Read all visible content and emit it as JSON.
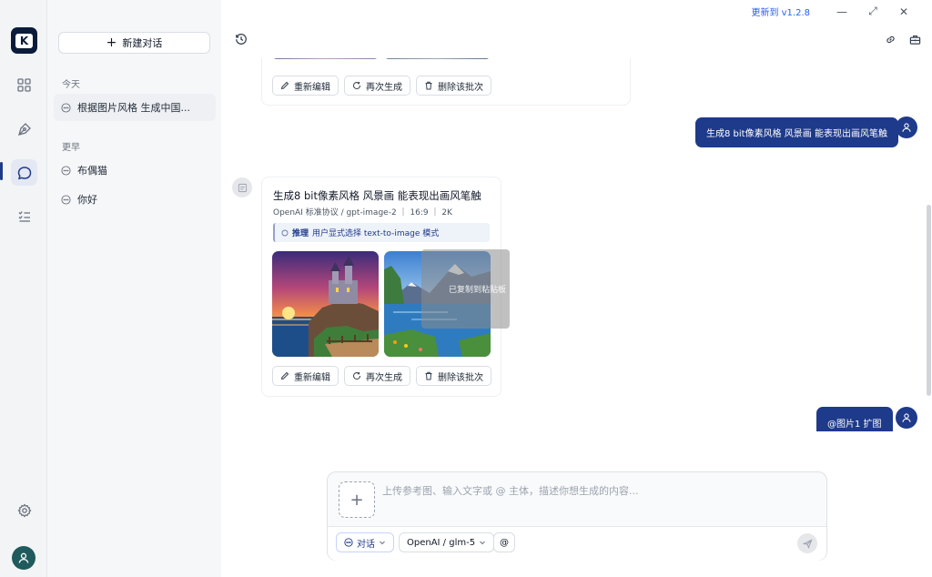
{
  "app": {
    "logo_letter": "K",
    "accent": "#1e3a8a"
  },
  "titlebar": {
    "update_label": "更新到 v1.2.8",
    "minimize": "—",
    "maximize": "⤢",
    "close": "✕"
  },
  "sidebar": {
    "new_chat_label": "新建对话",
    "groups": [
      {
        "label": "今天",
        "items": [
          {
            "title": "根据图片风格 生成中国..."
          }
        ]
      },
      {
        "label": "更早",
        "items": [
          {
            "title": "布偶猫"
          },
          {
            "title": "你好"
          }
        ]
      }
    ]
  },
  "messages": {
    "top_batch": {
      "actions": [
        "重新编辑",
        "再次生成",
        "删除该批次"
      ]
    },
    "user_1": {
      "text": "生成8 bit像素风格 风景画 能表现出画风笔触"
    },
    "assistant_1": {
      "title": "生成8 bit像素风格 风景画 能表现出画风笔触",
      "meta": "OpenAI 标准协议 / gpt-image-2 ｜ 16:9 ｜ 2K",
      "reasoning_label": "推理",
      "reasoning_text": "用户显式选择 text-to-image 模式",
      "tooltip_text": "已复制到粘贴板",
      "actions": [
        "重新编辑",
        "再次生成",
        "删除该批次"
      ]
    },
    "user_2": {
      "text": "@图片1 扩图"
    }
  },
  "composer": {
    "placeholder": "上传参考图、输入文字或 @ 主体，描述你想生成的内容...",
    "mode_label": "对话",
    "model_label": "OpenAI / glm-5",
    "at_label": "@"
  }
}
